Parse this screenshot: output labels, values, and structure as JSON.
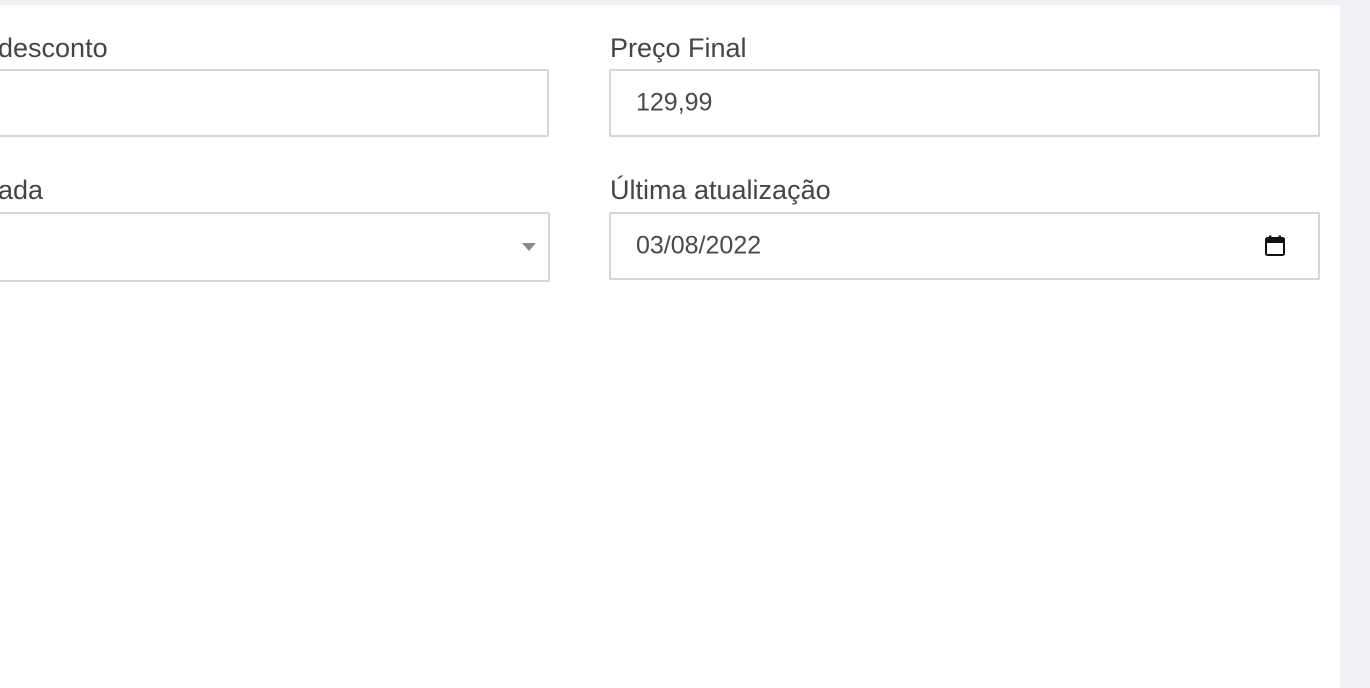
{
  "form": {
    "discount_label_fragment": "desconto",
    "discount_value": "",
    "select_label_fragment": "ada",
    "select_value": "",
    "final_price_label": "Preço Final",
    "final_price_value": "129,99",
    "last_update_label": "Última atualização",
    "last_update_value": "03/08/2022"
  },
  "icons": {
    "select_caret": "chevron-down-icon",
    "date_picker": "calendar-icon"
  },
  "colors": {
    "background": "#ffffff",
    "page_strip": "#f1f2f6",
    "field_border": "#d4d6dc",
    "text": "#454545"
  }
}
